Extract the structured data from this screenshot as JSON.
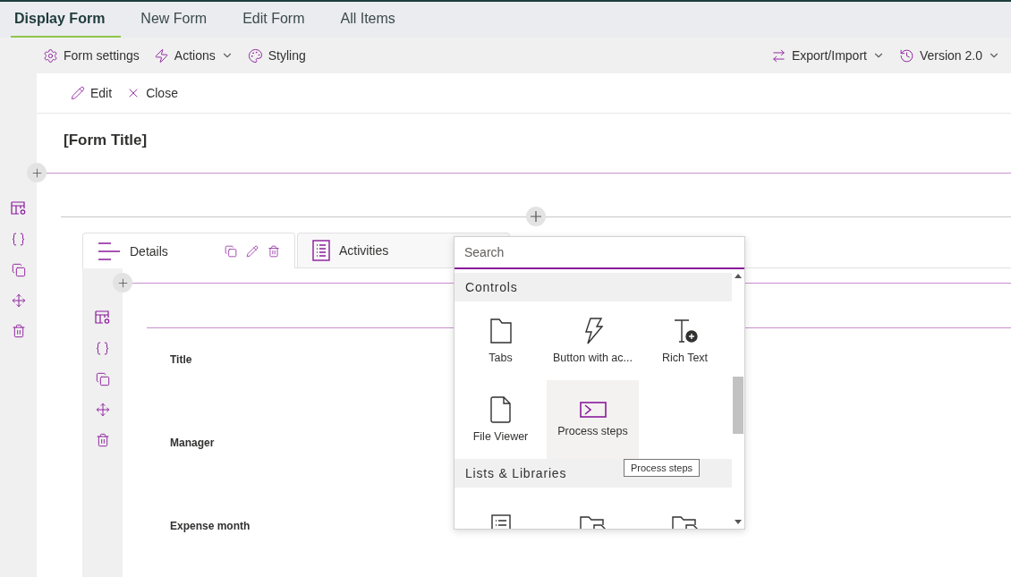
{
  "tabs": [
    {
      "label": "Display Form",
      "selected": true
    },
    {
      "label": "New Form",
      "selected": false
    },
    {
      "label": "Edit Form",
      "selected": false
    },
    {
      "label": "All Items",
      "selected": false
    }
  ],
  "toolbar": {
    "left": [
      {
        "label": "Form settings",
        "dropdown": false
      },
      {
        "label": "Actions",
        "dropdown": true
      },
      {
        "label": "Styling",
        "dropdown": false
      }
    ],
    "right": [
      {
        "label": "Export/Import",
        "dropdown": true
      },
      {
        "label": "Version 2.0",
        "dropdown": true
      }
    ]
  },
  "command_bar": [
    {
      "label": "Edit"
    },
    {
      "label": "Close"
    }
  ],
  "form_title": "[Form Title]",
  "form_tabs": [
    {
      "label": "Details",
      "selected": true
    },
    {
      "label": "Activities",
      "selected": false
    }
  ],
  "fields": [
    "Title",
    "Manager",
    "Expense month"
  ],
  "picker": {
    "placeholder": "Search",
    "sections": [
      {
        "title": "Controls",
        "items": [
          {
            "label": "Tabs",
            "hovered": false
          },
          {
            "label": "Button with ac...",
            "hovered": false
          },
          {
            "label": "Rich Text",
            "hovered": false
          },
          {
            "label": "File Viewer",
            "hovered": false
          },
          {
            "label": "Process steps",
            "hovered": true
          }
        ]
      },
      {
        "title": "Lists & Libraries",
        "items": [
          {
            "hovered": false
          },
          {
            "hovered": false
          },
          {
            "hovered": false
          }
        ]
      }
    ]
  },
  "tooltip": "Process steps"
}
